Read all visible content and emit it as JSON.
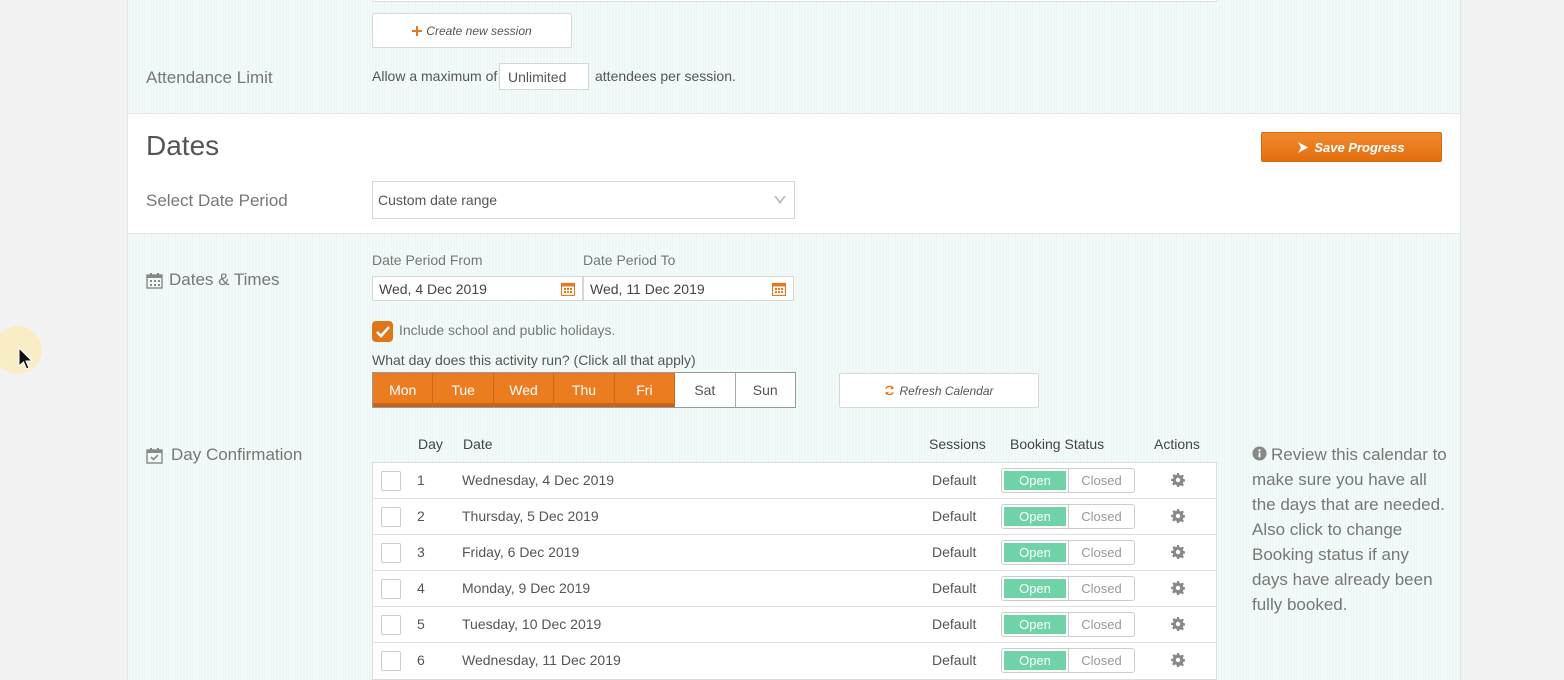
{
  "colors": {
    "accent": "#e87722",
    "open_green": "#6fd3a7",
    "band": "#edf7f5"
  },
  "session": {
    "create_label": "Create new session"
  },
  "attendance": {
    "label": "Attendance Limit",
    "prefix": "Allow a maximum of",
    "value": "Unlimited",
    "suffix": "attendees per session."
  },
  "dates": {
    "heading": "Dates",
    "save_label": "Save Progress",
    "period_label": "Select Date Period",
    "period_value": "Custom date range"
  },
  "dates_times": {
    "label": "Dates & Times",
    "from_label": "Date Period From",
    "from_value": "Wed, 4 Dec 2019",
    "to_label": "Date Period To",
    "to_value": "Wed, 11 Dec 2019",
    "holidays_label": "Include school and public holidays.",
    "question": "What day does this activity run? (Click all that apply)",
    "days": [
      {
        "label": "Mon",
        "on": true
      },
      {
        "label": "Tue",
        "on": true
      },
      {
        "label": "Wed",
        "on": true
      },
      {
        "label": "Thu",
        "on": true
      },
      {
        "label": "Fri",
        "on": true
      },
      {
        "label": "Sat",
        "on": false
      },
      {
        "label": "Sun",
        "on": false
      }
    ],
    "refresh_label": "Refresh Calendar"
  },
  "confirmation": {
    "label": "Day Confirmation",
    "headers": {
      "day": "Day",
      "date": "Date",
      "sessions": "Sessions",
      "status": "Booking Status",
      "actions": "Actions"
    },
    "rows": [
      {
        "day": "1",
        "date": "Wednesday, 4 Dec 2019",
        "sessions": "Default",
        "open": "Open",
        "closed": "Closed"
      },
      {
        "day": "2",
        "date": "Thursday, 5 Dec 2019",
        "sessions": "Default",
        "open": "Open",
        "closed": "Closed"
      },
      {
        "day": "3",
        "date": "Friday, 6 Dec 2019",
        "sessions": "Default",
        "open": "Open",
        "closed": "Closed"
      },
      {
        "day": "4",
        "date": "Monday, 9 Dec 2019",
        "sessions": "Default",
        "open": "Open",
        "closed": "Closed"
      },
      {
        "day": "5",
        "date": "Tuesday, 10 Dec 2019",
        "sessions": "Default",
        "open": "Open",
        "closed": "Closed"
      },
      {
        "day": "6",
        "date": "Wednesday, 11 Dec 2019",
        "sessions": "Default",
        "open": "Open",
        "closed": "Closed"
      }
    ],
    "note": "Review this calendar to make sure you have all the days that are needed. Also click to change Booking status if any days have already been fully booked."
  }
}
